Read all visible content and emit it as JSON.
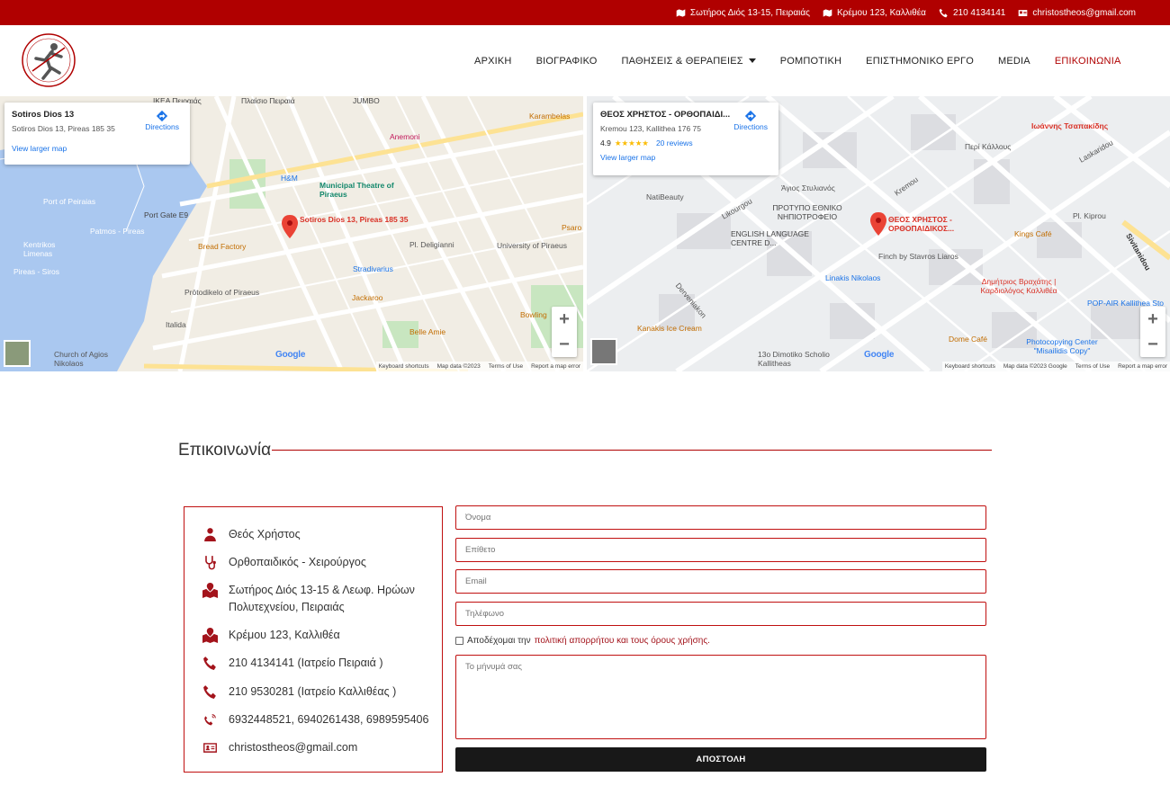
{
  "topbar": {
    "items": [
      {
        "icon": "map-icon",
        "text": "Σωτήρος Διός 13-15, Πειραιάς"
      },
      {
        "icon": "map-icon",
        "text": "Κρέμου 123, Καλλιθέα"
      },
      {
        "icon": "phone-icon",
        "text": "210 4134141"
      },
      {
        "icon": "id-card-icon",
        "text": "christostheos@gmail.com"
      }
    ]
  },
  "nav": {
    "items": [
      "ΑΡΧΙΚΗ",
      "ΒΙΟΓΡΑΦΙΚΟ",
      "ΠΑΘΗΣΕΙΣ & ΘΕΡΑΠΕΙΕΣ",
      "ΡΟΜΠΟΤΙΚΗ",
      "ΕΠΙΣΤΗΜΟΝΙΚΟ ΕΡΓΟ",
      "MEDIA",
      "ΕΠΙΚΟΙΝΩΝΙΑ"
    ],
    "active": "ΕΠΙΚΟΙΝΩΝΙΑ"
  },
  "map1": {
    "card_name": "Sotiros Dios 13",
    "card_addr": "Sotiros Dios 13, Pireas 185 35",
    "card_link": "View larger map",
    "directions": "Directions",
    "pin_label": "Sotiros Dios 13, Pireas 185 35",
    "labels": [
      "IKEA Πειραιάς",
      "Πλαίσιο Πειραιά",
      "JUMBO",
      "Karambelas",
      "Anemoni",
      "H&M",
      "Municipal Theatre of Piraeus",
      "Port of Peiraias",
      "Port Gate E9",
      "Kentrikos Limenas",
      "Patmos - Pireas",
      "Pireas - Siros",
      "Bread Factory",
      "Pl. Deligianni",
      "University of Piraeus",
      "Stradivarius",
      "Jackaroo",
      "Prōtodikelo of Piraeus",
      "Belle Amie",
      "Bowling",
      "Italida",
      "Church of Agios Nikolaos",
      "Psaro"
    ],
    "footer": [
      "Keyboard shortcuts",
      "Map data ©2023",
      "Terms of Use",
      "Report a map error"
    ],
    "google": "Google"
  },
  "map2": {
    "card_name": "ΘΕΟΣ ΧΡΗΣΤΟΣ - ΟΡΘΟΠΑΙΔΙ...",
    "card_addr": "Kremou 123, Kallithea 176 75",
    "rating": "4.9",
    "stars": "★★★★★",
    "reviews": "20 reviews",
    "card_link": "View larger map",
    "directions": "Directions",
    "pin_label": "ΘΕΟΣ ΧΡΗΣΤΟΣ - ΟΡΘΟΠΑΙΔΙΚΟΣ...",
    "labels": [
      "Ιωάννης Τσαπακίδης",
      "Περί Κάλλους",
      "Άγιος Στυλιανός",
      "NatiBeauty",
      "ΠΡΟΤΥΠΟ ΕΘΝΙΚΟ ΝΗΠΙΟΤΡΟΦΕΙΟ",
      "ENGLISH LANGUAGE CENTRE D...",
      "Kings Café",
      "Pl. Kiprou",
      "Finch by Stavros Liaros",
      "Linakis Nikolaos",
      "Δημήτριος Βραχάτης | Καρδιολόγος Καλλιθέα",
      "POP-AIR Kallithea Sto",
      "Kanakis Ice Cream",
      "Dome Café",
      "Photocopying Center \"Misailidis Copy\"",
      "13o Dimotiko Scholio Kallitheas",
      "Sivitanidou",
      "Laskaridou",
      "Kremou",
      "Likourgou",
      "Derveniakon"
    ],
    "footer": [
      "Keyboard shortcuts",
      "Map data ©2023 Google",
      "Terms of Use",
      "Report a map error"
    ],
    "google": "Google"
  },
  "section": {
    "title": "Επικοινωνία"
  },
  "info": {
    "name": "Θεός Χρήστος",
    "title": "Ορθοπαιδικός - Χειρούργος",
    "addr1_line1": "Σωτήρος Διός 13-15 & Λεωφ. Ηρώων",
    "addr1_line2": "Πολυτεχνείου, Πειραιάς",
    "addr2": "Κρέμου 123, Καλλιθέα",
    "phone1": "210 4134141 (Ιατρείο Πειραιά )",
    "phone2": "210 9530281 (Ιατρείο Καλλιθέας )",
    "mobiles": "6932448521, 6940261438, 6989595406",
    "email": "christostheos@gmail.com"
  },
  "form": {
    "name_ph": "Όνομα",
    "surname_ph": "Επίθετο",
    "email_ph": "Email",
    "phone_ph": "Τηλέφωνο",
    "consent_pre": "Αποδέχομαι την",
    "consent_link": "πολιτική απορρήτου και τους όρους χρήσης.",
    "message_ph": "Το μήνυμά σας",
    "submit": "ΑΠΟΣΤΟΛΗ"
  },
  "colors": {
    "brand": "#b00000",
    "button": "#181818",
    "link": "#1a73e8"
  }
}
